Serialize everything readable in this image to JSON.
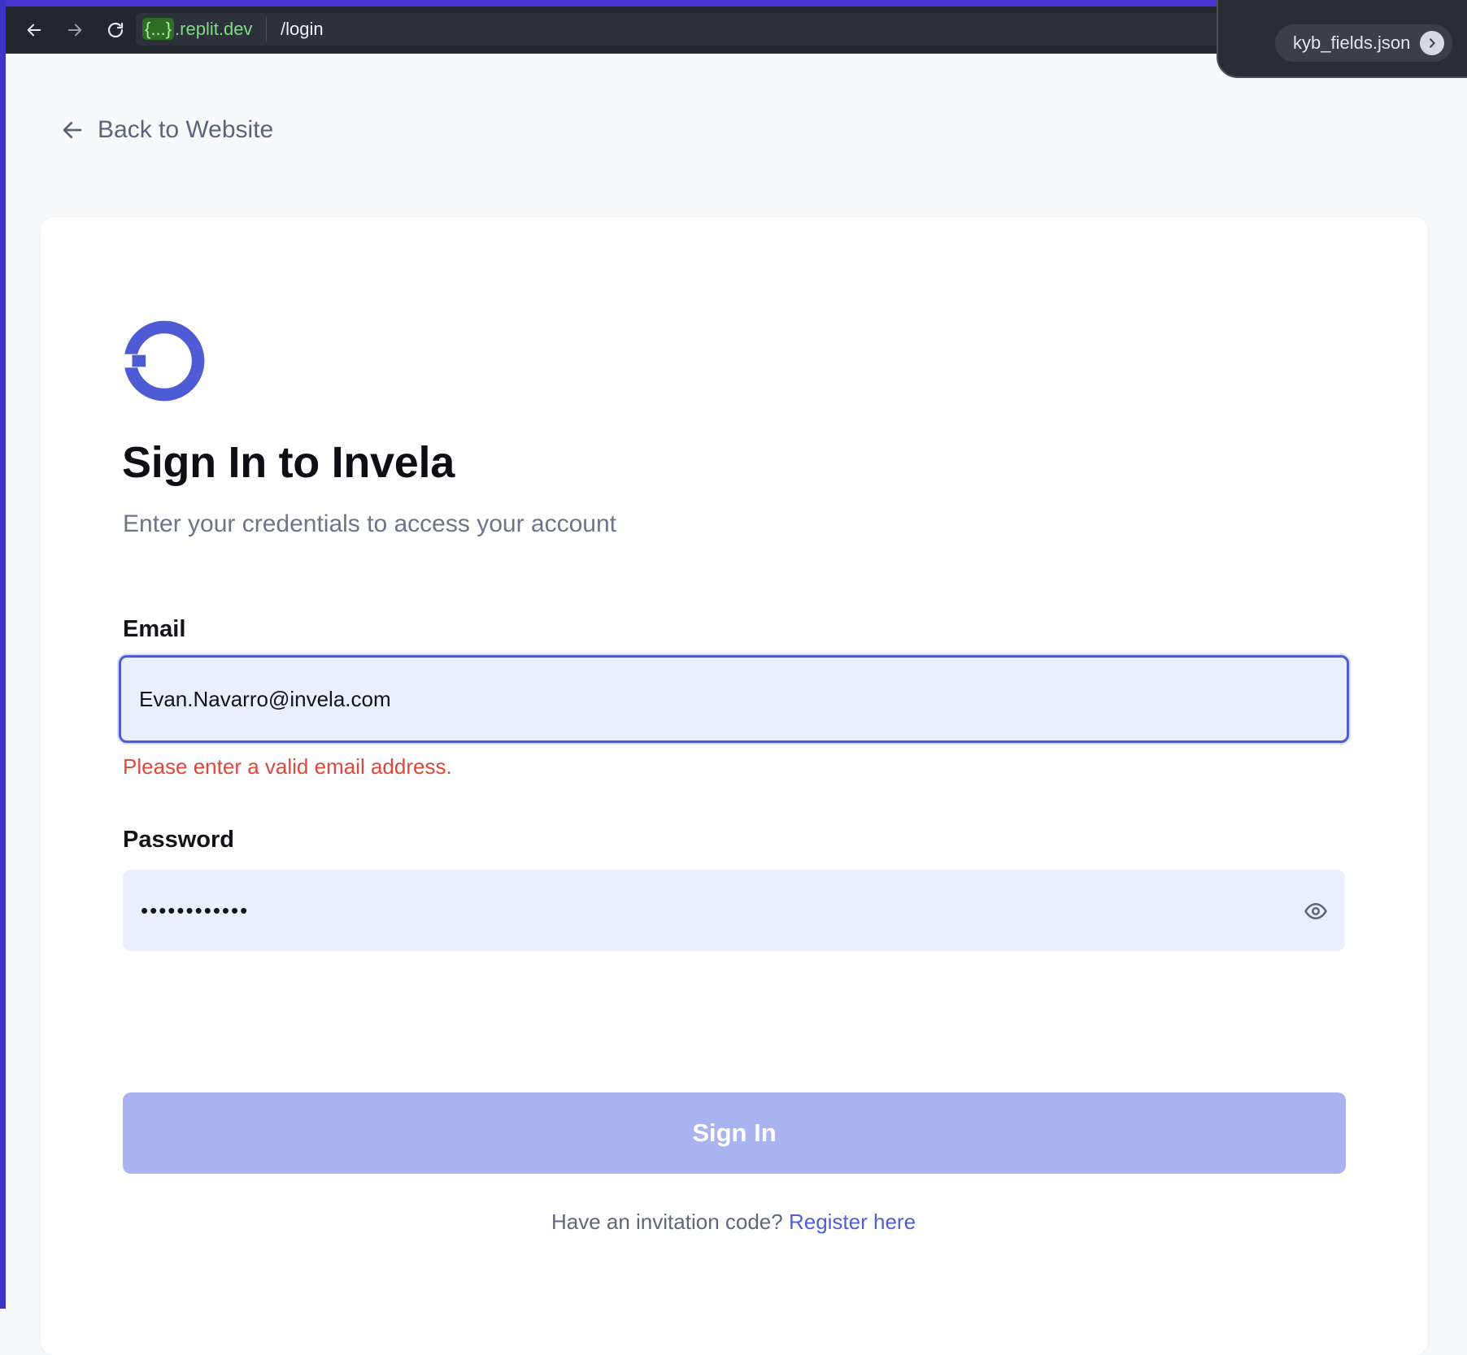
{
  "browser": {
    "host_chip": "{...}",
    "host": ".replit.dev",
    "path": "/login",
    "overlay_file": "kyb_fields.json"
  },
  "page": {
    "back_link": "Back to Website",
    "title": "Sign In to Invela",
    "subtitle": "Enter your credentials to access your account"
  },
  "form": {
    "email_label": "Email",
    "email_value": "Evan.Navarro@invela.com",
    "email_error": "Please enter a valid email address.",
    "password_label": "Password",
    "password_mask": "••••••••••••",
    "submit_label": "Sign In"
  },
  "footer": {
    "prompt": "Have an invitation code?",
    "register_link": "Register here"
  },
  "colors": {
    "brand": "#4f5bd5",
    "button_disabled": "#a9b3f0",
    "error": "#e0473b",
    "input_bg": "#e8f0fe"
  }
}
